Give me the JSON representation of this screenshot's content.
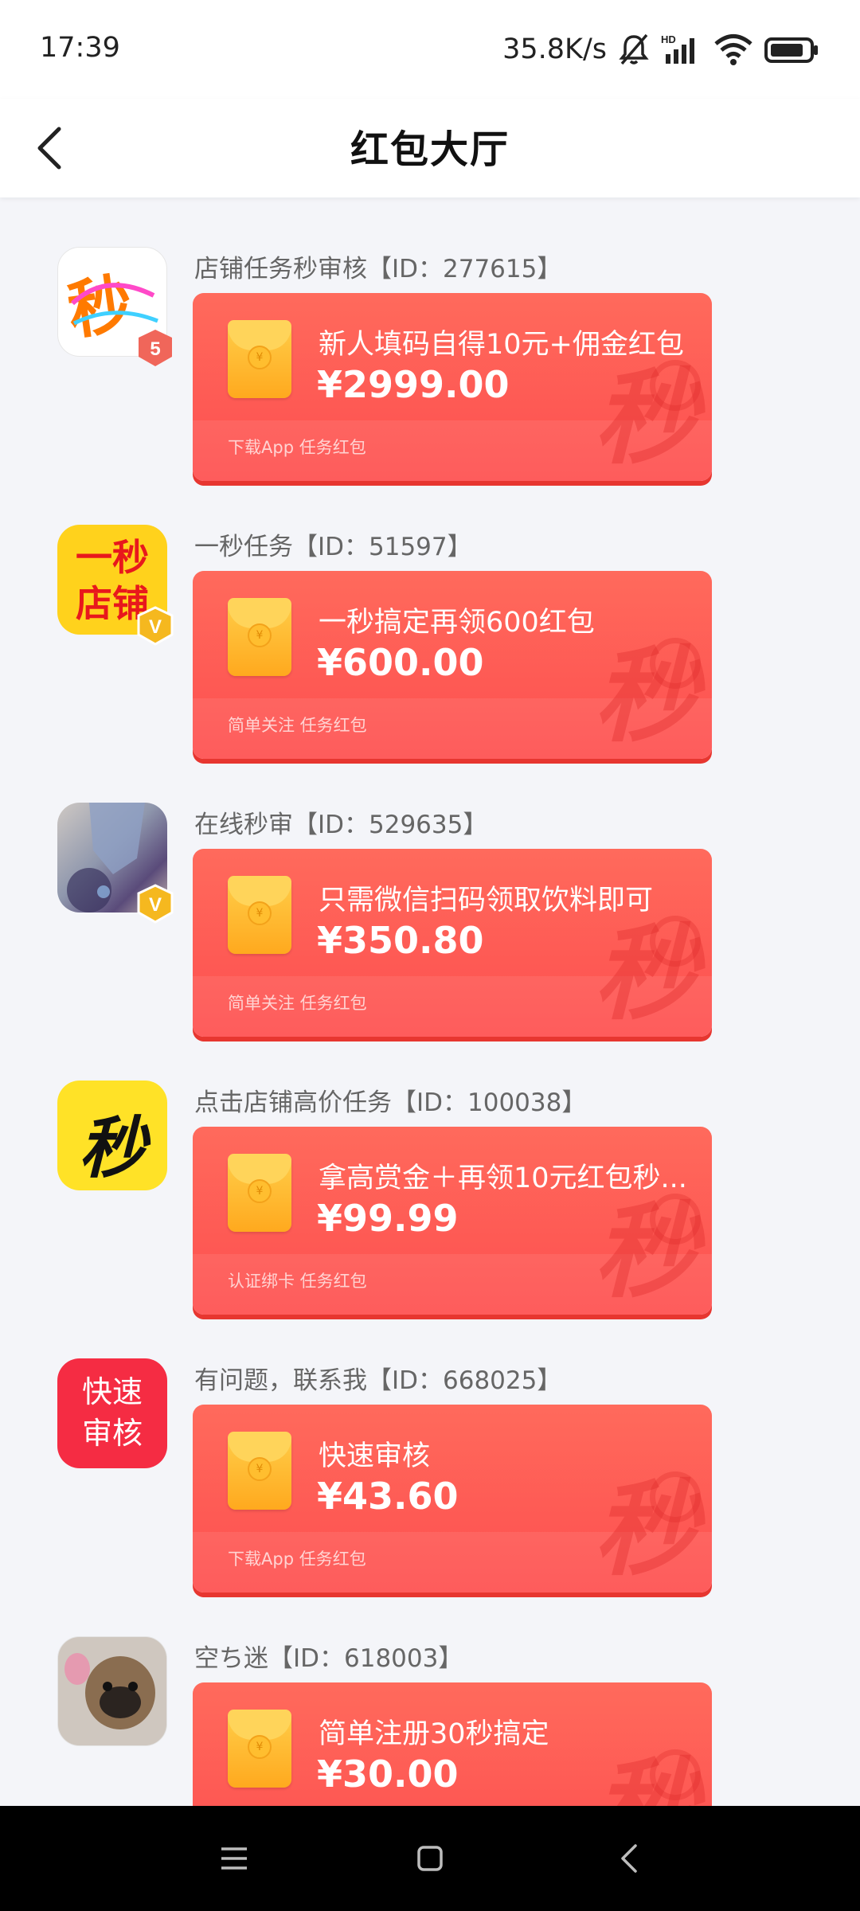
{
  "status_bar": {
    "time": "17:39",
    "speed": "35.8K/s"
  },
  "header": {
    "title": "红包大厅"
  },
  "items": [
    {
      "shop": "店铺任务秒审核【ID：277615】",
      "title": "新人填码自得10元+佣金红包",
      "amount": "¥2999.00",
      "tags": "下载App 任务红包",
      "avatar_text": "秒",
      "badge": "5"
    },
    {
      "shop": "一秒任务【ID：51597】",
      "title": "一秒搞定再领600红包",
      "amount": "¥600.00",
      "tags": "简单关注 任务红包",
      "avatar_text": "一秒\n店铺",
      "badge": "V"
    },
    {
      "shop": "在线秒审【ID：529635】",
      "title": "只需微信扫码领取饮料即可",
      "amount": "¥350.80",
      "tags": "简单关注 任务红包",
      "avatar_text": "",
      "badge": "V"
    },
    {
      "shop": "点击店铺高价任务【ID：100038】",
      "title": "拿高赏金＋再领10元红包秒...",
      "amount": "¥99.99",
      "tags": "认证绑卡 任务红包",
      "avatar_text": "秒",
      "badge": ""
    },
    {
      "shop": "有问题，联系我【ID：668025】",
      "title": "快速审核",
      "amount": "¥43.60",
      "tags": "下载App 任务红包",
      "avatar_text": "快速\n审核",
      "badge": ""
    },
    {
      "shop": "空ち迷【ID：618003】",
      "title": "简单注册30秒搞定",
      "amount": "¥30.00",
      "tags": "",
      "avatar_text": "",
      "badge": ""
    }
  ],
  "card_watermark": "秒",
  "envelope_coin": "¥",
  "colors": {
    "card": "#fe5151",
    "card_shadow": "#e73630",
    "envelope": "#ffb52a",
    "background": "#f4f5f9"
  },
  "icons": {
    "back": "chevron-left-icon",
    "mute": "bell-off-icon",
    "signal": "signal-icon",
    "wifi": "wifi-icon",
    "battery": "battery-icon",
    "menu": "menu-icon",
    "home": "home-square-icon",
    "nav_back": "nav-back-icon"
  }
}
